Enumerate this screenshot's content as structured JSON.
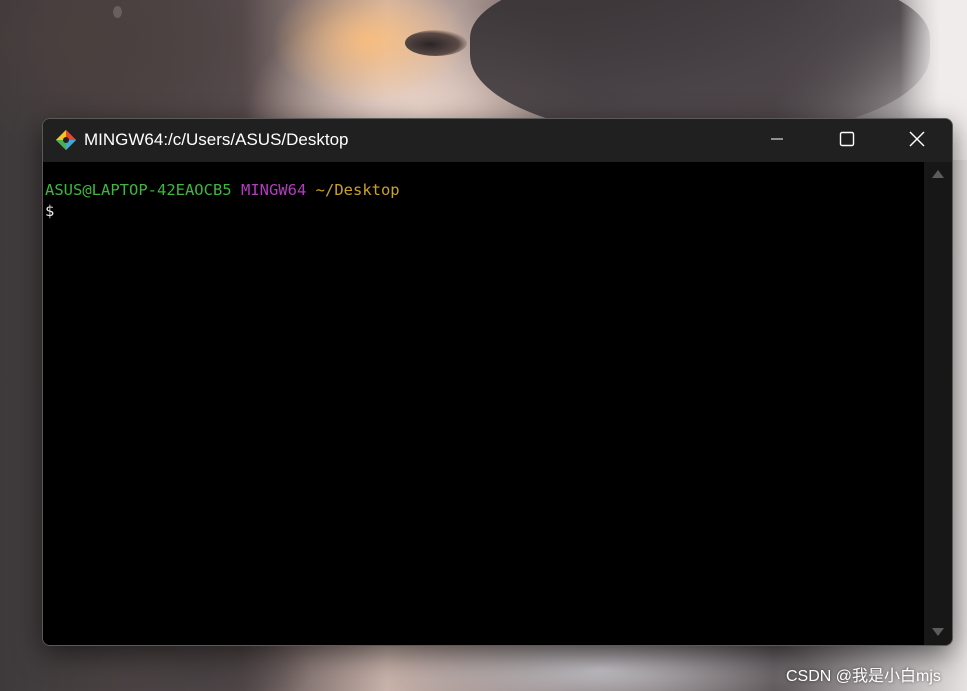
{
  "window": {
    "title": "MINGW64:/c/Users/ASUS/Desktop",
    "app_icon": "git-bash-icon",
    "controls": {
      "minimize_icon": "minimize-icon",
      "maximize_icon": "maximize-icon",
      "close_icon": "close-icon"
    }
  },
  "terminal": {
    "prompt": {
      "user_host": "ASUS@LAPTOP-42EAOCB5",
      "system": "MINGW64",
      "path": "~/Desktop",
      "symbol": "$"
    },
    "colors": {
      "user_host": "#3cb83c",
      "system": "#b43cbf",
      "path": "#c9a322",
      "background": "#000000",
      "titlebar": "#202020"
    }
  },
  "watermark": {
    "text": "CSDN @我是小白mjs"
  }
}
